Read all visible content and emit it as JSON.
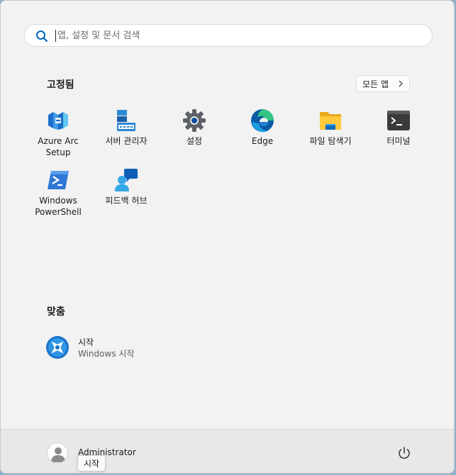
{
  "search": {
    "placeholder": "앱, 설정 및 문서 검색",
    "icon": "search-icon"
  },
  "pinned": {
    "title": "고정됨",
    "all_apps_label": "모든 앱",
    "apps": [
      {
        "label": "Azure Arc Setup",
        "icon": "azure-arc-icon"
      },
      {
        "label": "서버 관리자",
        "icon": "server-manager-icon"
      },
      {
        "label": "설정",
        "icon": "settings-gear-icon"
      },
      {
        "label": "Edge",
        "icon": "edge-icon"
      },
      {
        "label": "파일 탐색기",
        "icon": "folder-icon"
      },
      {
        "label": "터미널",
        "icon": "terminal-icon"
      },
      {
        "label_line1": "Windows",
        "label_line2": "PowerShell",
        "icon": "powershell-icon"
      },
      {
        "label": "피드백 허브",
        "icon": "feedback-hub-icon"
      }
    ]
  },
  "recommended": {
    "title": "맞춤",
    "items": [
      {
        "title": "시작",
        "subtitle": "Windows 시작",
        "icon": "get-started-icon"
      }
    ]
  },
  "footer": {
    "user_name": "Administrator",
    "tooltip": "시작",
    "power_icon": "power-icon"
  },
  "colors": {
    "accent": "#0067c0",
    "background": "#f2f2f2",
    "footer": "#e8e8e8"
  }
}
